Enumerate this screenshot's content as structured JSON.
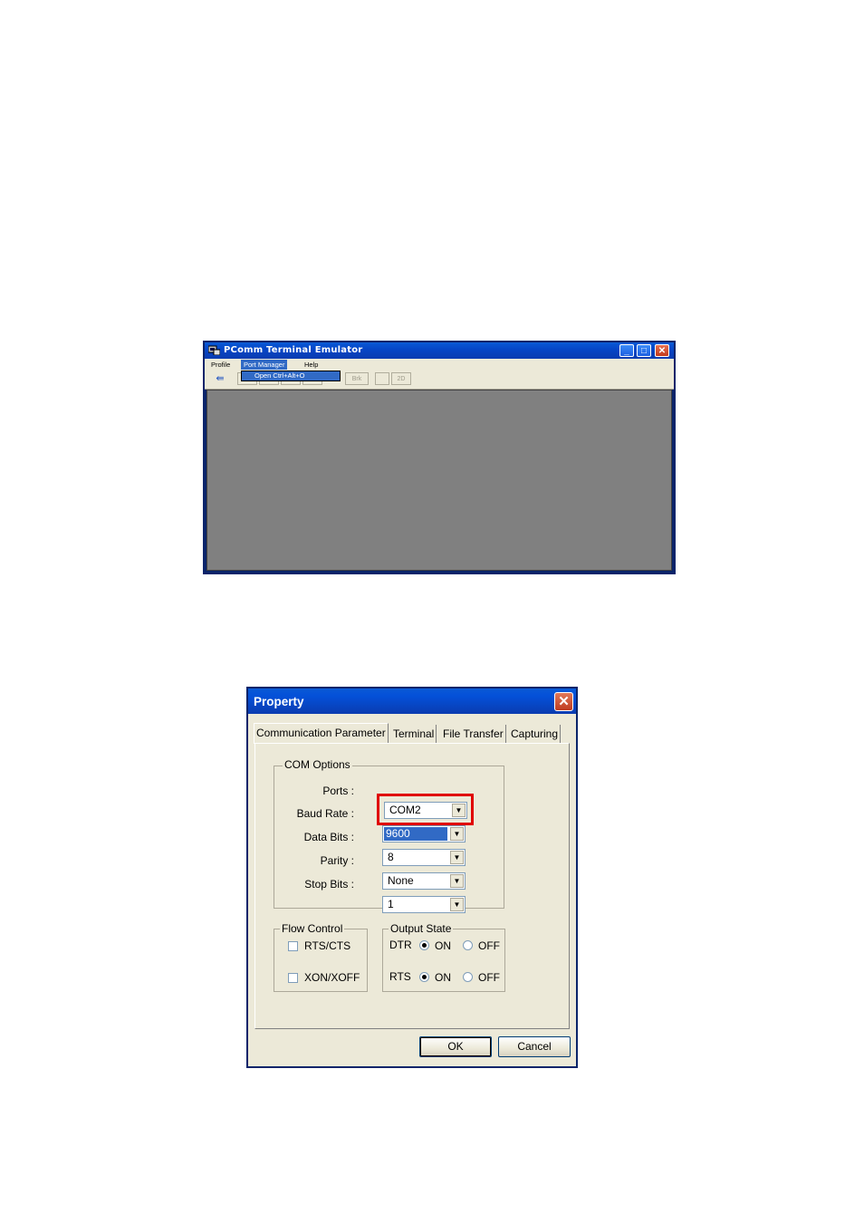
{
  "pcomm": {
    "title": "PComm Terminal Emulator",
    "menu": [
      "Profile",
      "Port Manager",
      "Help"
    ],
    "dropdown_item": "Open  Ctrl+Alt+O",
    "toolbar": {
      "brk_label": "Brk",
      "label_2d": "2D"
    },
    "caption_buttons": {
      "minimize": "_",
      "maximize": "□",
      "close": "✕"
    }
  },
  "property": {
    "title": "Property",
    "close_glyph": "✕",
    "tabs": [
      "Communication Parameter",
      "Terminal",
      "File Transfer",
      "Capturing"
    ],
    "com_options": {
      "group_label": "COM Options",
      "fields": [
        {
          "label": "Ports :",
          "value": "COM2"
        },
        {
          "label": "Baud Rate :",
          "value": "9600"
        },
        {
          "label": "Data Bits :",
          "value": "8"
        },
        {
          "label": "Parity :",
          "value": "None"
        },
        {
          "label": "Stop Bits :",
          "value": "1"
        }
      ]
    },
    "flow_control": {
      "group_label": "Flow Control",
      "rts_cts": "RTS/CTS",
      "xon_xoff": "XON/XOFF"
    },
    "output_state": {
      "group_label": "Output State",
      "dtr": "DTR",
      "rts": "RTS",
      "on": "ON",
      "off": "OFF"
    },
    "buttons": {
      "ok": "OK",
      "cancel": "Cancel"
    }
  },
  "colors": {
    "xp_blue": "#0a5ad6",
    "face": "#ece9d8",
    "client_gray": "#808080",
    "highlight_red": "#e00000",
    "selection": "#316ac5"
  },
  "icons": [
    "pcomm-app-icon",
    "minimize-icon",
    "maximize-icon",
    "close-icon",
    "dropdown-arrow-icon"
  ]
}
